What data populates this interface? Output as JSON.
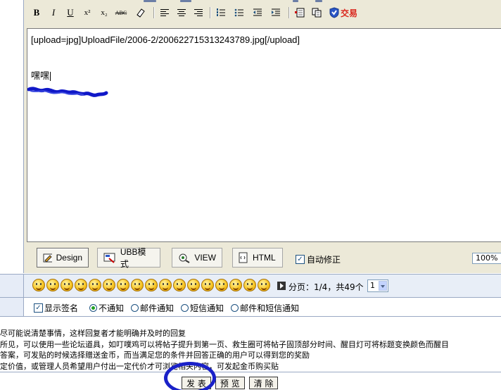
{
  "toolbar": {
    "buttons": [
      "B",
      "I",
      "U",
      "x²",
      "x₂",
      "ABC"
    ],
    "trade_label": "交易"
  },
  "editor": {
    "upload_line": "[upload=jpg]UploadFile/2006-2/200622715313243789.jpg[/upload]",
    "body_text": "嘿嘿"
  },
  "modes": [
    {
      "label": "Design",
      "icon": "design-icon"
    },
    {
      "label": "UBB模式",
      "icon": "ubb-icon"
    },
    {
      "label": "VIEW",
      "icon": "view-icon"
    },
    {
      "label": "HTML",
      "icon": "html-icon"
    }
  ],
  "autofix": {
    "label": "自动修正",
    "checked": true
  },
  "zoom": "100%",
  "paging": {
    "text": "分页：1/4，共49个",
    "selected": "1"
  },
  "options": {
    "signature": "显示签名",
    "no_notify": "不通知",
    "mail_notify": "邮件通知",
    "sms_notify": "短信通知",
    "mail_sms_notify": "邮件和短信通知"
  },
  "tips": [
    "尽可能说清楚事情，这样回复者才能明确并及时的回复",
    "所见，可以使用一些论坛道具，如叮噗鸡可以将帖子提升到第一页、救生圈可将帖子固顶部分时间、醒目灯可将标题变换颜色而醒目",
    "答案，可发贴的时候选择赠送金币，而当满足您的条件并回答正确的用户可以得到您的奖励",
    "定价值，或管理人员希望用户付出一定代价才可浏览相关内容，可发起金币购买贴"
  ],
  "buttons": {
    "submit": "发 表",
    "preview": "预 览",
    "clear": "清 除"
  },
  "colors": {
    "accent_circle": "#1a21c8",
    "toolbar_bg": "#ece9d8",
    "trade_red": "#d9261c"
  }
}
